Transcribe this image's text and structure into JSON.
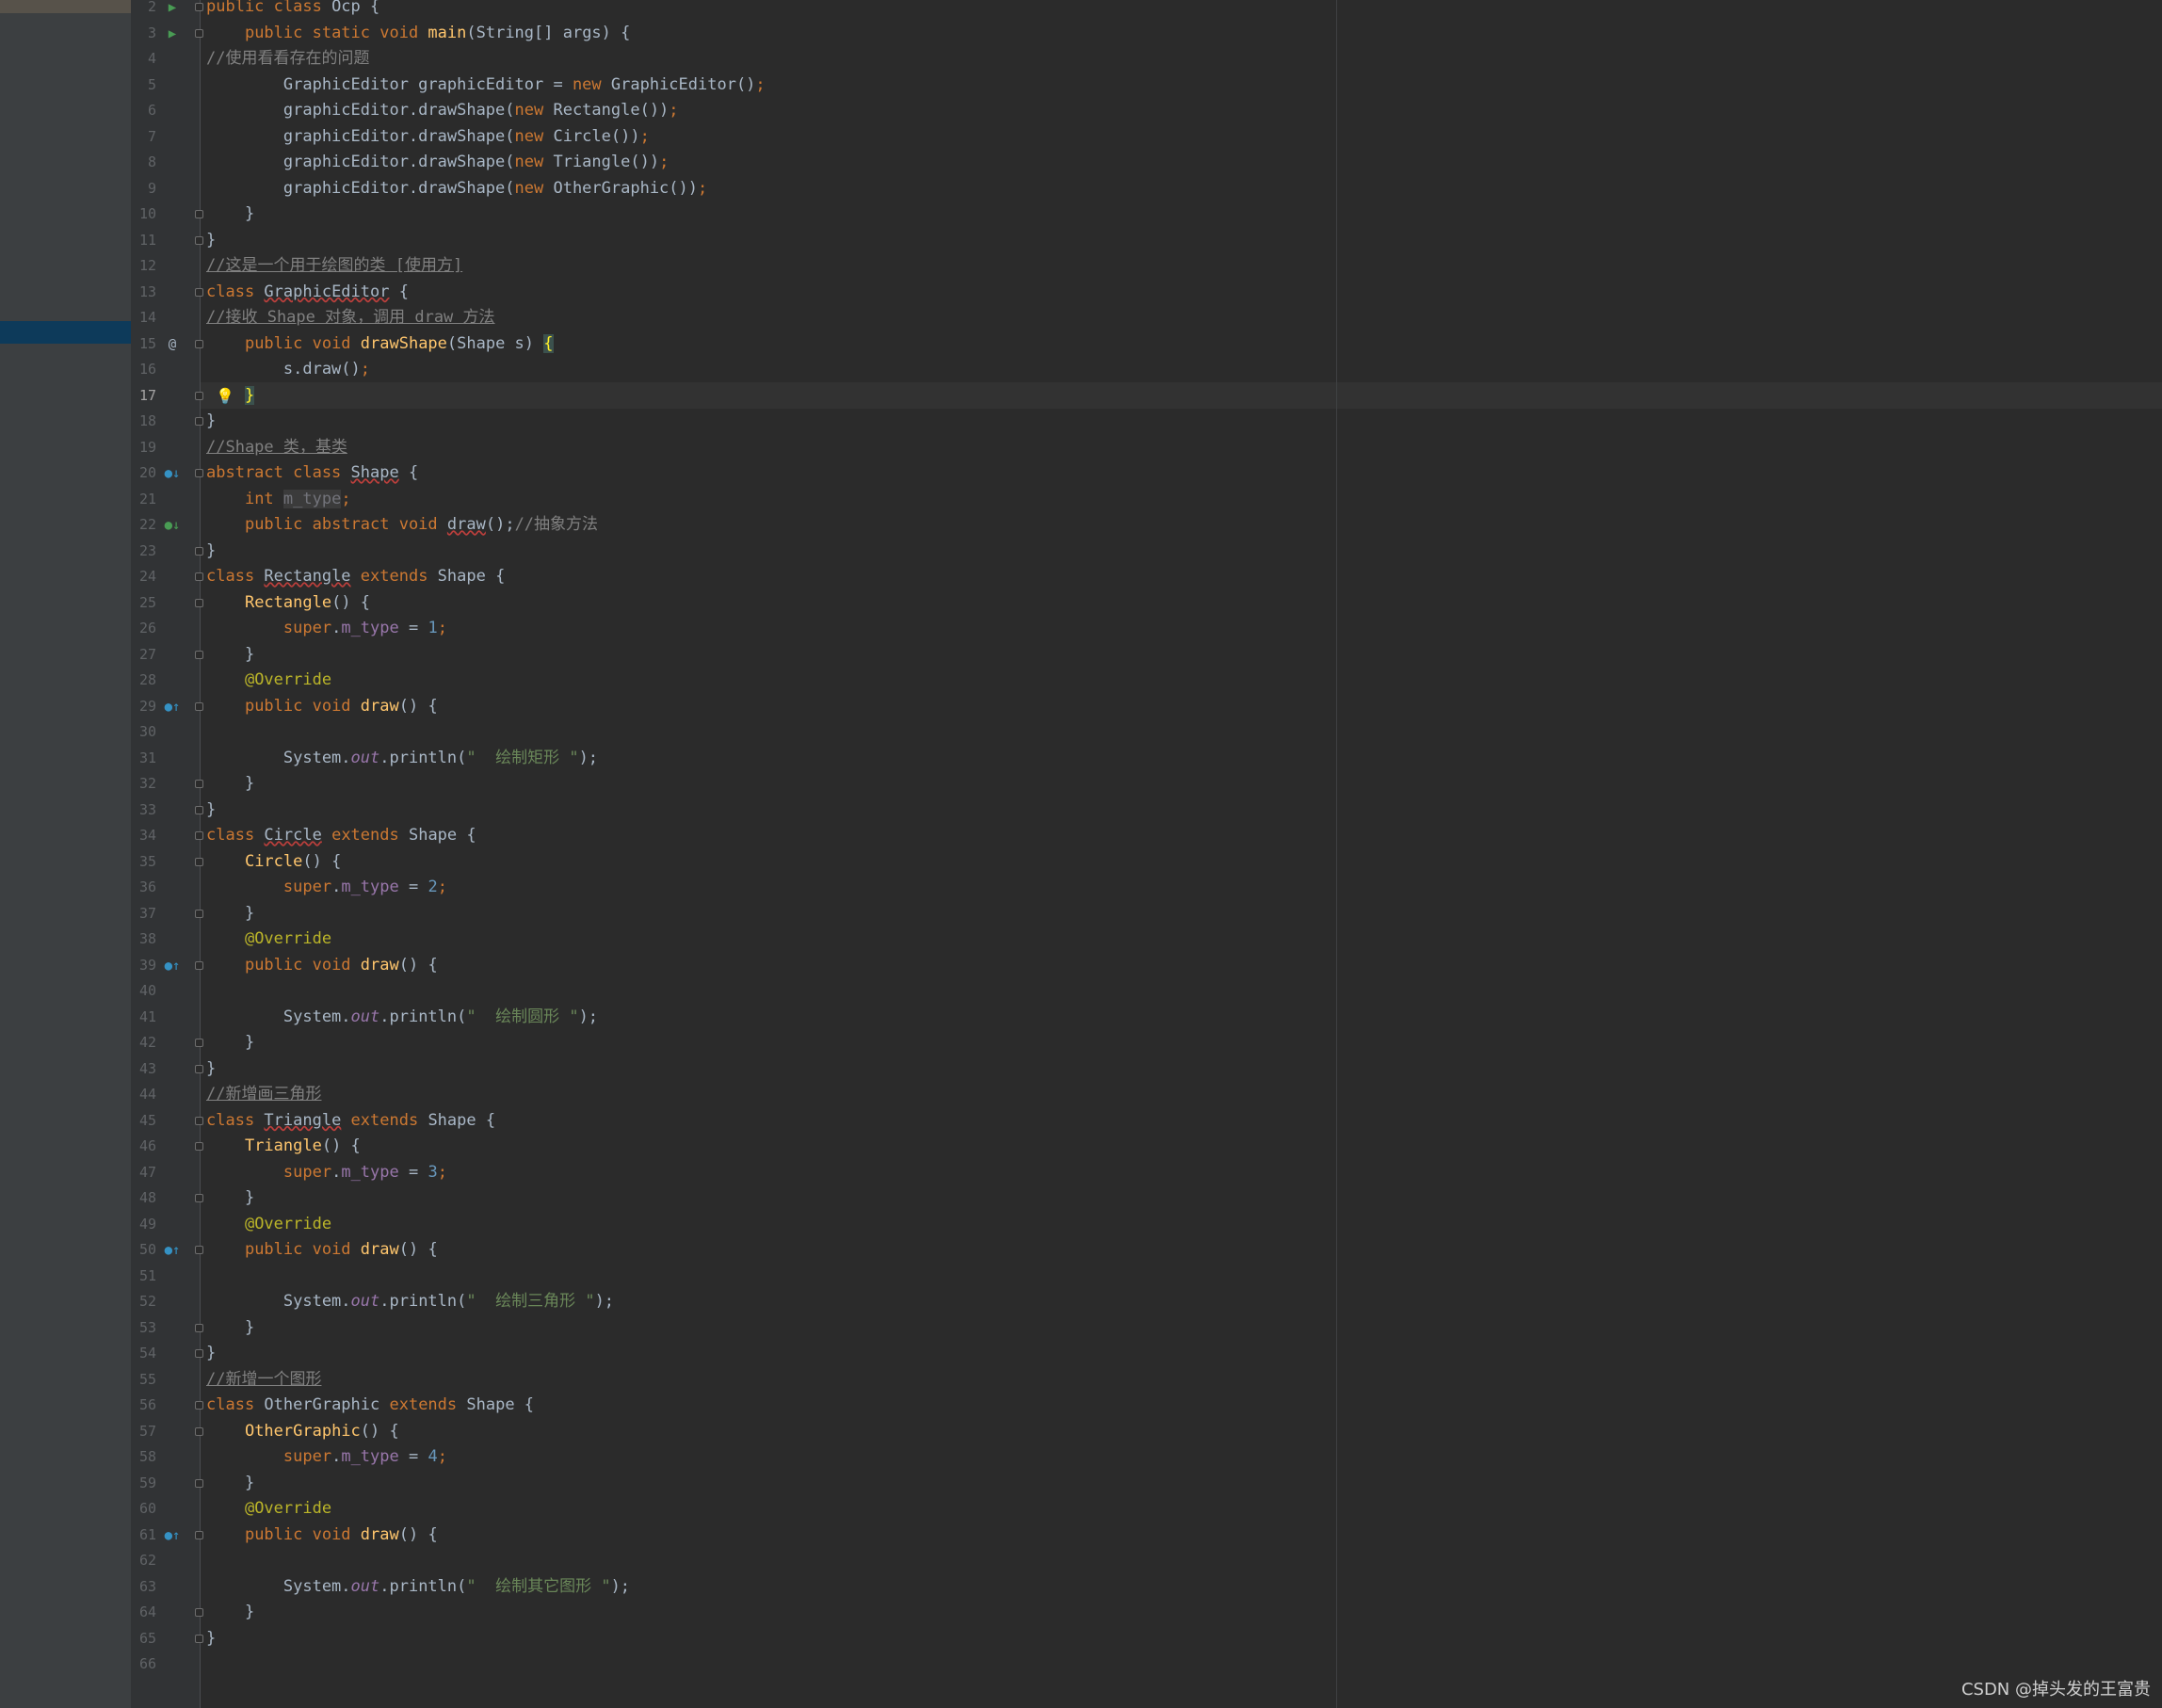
{
  "editor": {
    "current_line": "17",
    "watermark": "CSDN @掉头发的王富贵"
  },
  "lines": [
    {
      "n": "2",
      "segs": [
        [
          "kw",
          "public class "
        ],
        [
          "",
          "Ocp {"
        ]
      ],
      "icon": "run",
      "fold": true
    },
    {
      "n": "3",
      "segs": [
        [
          "",
          "    "
        ],
        [
          "kw",
          "public static void "
        ],
        [
          "fn",
          "main"
        ],
        [
          "",
          "(String[] args) {"
        ]
      ],
      "icon": "run",
      "fold": true
    },
    {
      "n": "4",
      "segs": [
        [
          "cm",
          "//使用看看存在的问题"
        ]
      ]
    },
    {
      "n": "5",
      "segs": [
        [
          "",
          "        GraphicEditor graphicEditor = "
        ],
        [
          "kw",
          "new "
        ],
        [
          "",
          "GraphicEditor()"
        ],
        [
          "kw",
          ";"
        ]
      ]
    },
    {
      "n": "6",
      "segs": [
        [
          "",
          "        graphicEditor.drawShape("
        ],
        [
          "kw",
          "new "
        ],
        [
          "",
          "Rectangle())"
        ],
        [
          "kw",
          ";"
        ]
      ]
    },
    {
      "n": "7",
      "segs": [
        [
          "",
          "        graphicEditor.drawShape("
        ],
        [
          "kw",
          "new "
        ],
        [
          "",
          "Circle())"
        ],
        [
          "kw",
          ";"
        ]
      ]
    },
    {
      "n": "8",
      "segs": [
        [
          "",
          "        graphicEditor.drawShape("
        ],
        [
          "kw",
          "new "
        ],
        [
          "",
          "Triangle())"
        ],
        [
          "kw",
          ";"
        ]
      ]
    },
    {
      "n": "9",
      "segs": [
        [
          "",
          "        graphicEditor.drawShape("
        ],
        [
          "kw",
          "new "
        ],
        [
          "",
          "OtherGraphic())"
        ],
        [
          "kw",
          ";"
        ]
      ]
    },
    {
      "n": "10",
      "segs": [
        [
          "",
          "    }"
        ]
      ],
      "fold": true
    },
    {
      "n": "11",
      "segs": [
        [
          "",
          "}"
        ]
      ],
      "fold": true
    },
    {
      "n": "12",
      "segs": [
        [
          "cmu",
          "//这是一个用于绘图的类 [使用方]"
        ]
      ]
    },
    {
      "n": "13",
      "segs": [
        [
          "kw",
          "class "
        ],
        [
          "err",
          "GraphicEditor"
        ],
        [
          "",
          " {"
        ]
      ],
      "fold": true
    },
    {
      "n": "14",
      "segs": [
        [
          "cmu",
          "//接收 Shape 对象，调用 draw 方法"
        ]
      ]
    },
    {
      "n": "15",
      "segs": [
        [
          "",
          "    "
        ],
        [
          "kw",
          "public void "
        ],
        [
          "fn",
          "drawShape"
        ],
        [
          "",
          "(Shape s) "
        ],
        [
          "brc",
          "{"
        ]
      ],
      "icon": "at",
      "fold": true
    },
    {
      "n": "16",
      "segs": [
        [
          "",
          "        s.draw()"
        ],
        [
          "kw",
          ";"
        ]
      ]
    },
    {
      "n": "17",
      "segs": [
        [
          "",
          "    "
        ],
        [
          "brc",
          "}"
        ]
      ],
      "fold": true,
      "bulb": true,
      "current": true
    },
    {
      "n": "18",
      "segs": [
        [
          "",
          "}"
        ]
      ],
      "fold": true
    },
    {
      "n": "19",
      "segs": [
        [
          "cmu",
          "//Shape 类，基类"
        ]
      ]
    },
    {
      "n": "20",
      "segs": [
        [
          "kw",
          "abstract class "
        ],
        [
          "err",
          "Shape"
        ],
        [
          "",
          " {"
        ]
      ],
      "icon": "impl-down",
      "fold": true
    },
    {
      "n": "21",
      "segs": [
        [
          "",
          "    "
        ],
        [
          "kw",
          "int "
        ],
        [
          "unused",
          "m_type"
        ],
        [
          "kw",
          ";"
        ]
      ]
    },
    {
      "n": "22",
      "segs": [
        [
          "",
          "    "
        ],
        [
          "kw",
          "public abstract void "
        ],
        [
          "err",
          "draw"
        ],
        [
          "",
          "();"
        ],
        [
          "cm",
          "//抽象方法"
        ]
      ],
      "icon": "impl-down-green"
    },
    {
      "n": "23",
      "segs": [
        [
          "",
          "}"
        ]
      ],
      "fold": true
    },
    {
      "n": "24",
      "segs": [
        [
          "kw",
          "class "
        ],
        [
          "err",
          "Rectangle"
        ],
        [
          "kw",
          " extends "
        ],
        [
          "",
          "Shape {"
        ]
      ],
      "fold": true
    },
    {
      "n": "25",
      "segs": [
        [
          "",
          "    "
        ],
        [
          "fn",
          "Rectangle"
        ],
        [
          "",
          "() {"
        ]
      ],
      "fold": true
    },
    {
      "n": "26",
      "segs": [
        [
          "",
          "        "
        ],
        [
          "kw",
          "super"
        ],
        [
          "",
          "."
        ],
        [
          "fld",
          "m_type"
        ],
        [
          "",
          " = "
        ],
        [
          "num",
          "1"
        ],
        [
          "kw",
          ";"
        ]
      ]
    },
    {
      "n": "27",
      "segs": [
        [
          "",
          "    }"
        ]
      ],
      "fold": true
    },
    {
      "n": "28",
      "segs": [
        [
          "",
          "    "
        ],
        [
          "ann",
          "@Override"
        ]
      ]
    },
    {
      "n": "29",
      "segs": [
        [
          "",
          "    "
        ],
        [
          "kw",
          "public void "
        ],
        [
          "fn",
          "draw"
        ],
        [
          "",
          "() {"
        ]
      ],
      "icon": "override-up",
      "fold": true
    },
    {
      "n": "30",
      "segs": []
    },
    {
      "n": "31",
      "segs": [
        [
          "",
          "        System."
        ],
        [
          "fldi",
          "out"
        ],
        [
          "",
          ".println("
        ],
        [
          "st",
          "\"  绘制矩形 \""
        ],
        [
          "",
          "); "
        ]
      ]
    },
    {
      "n": "32",
      "segs": [
        [
          "",
          "    }"
        ]
      ],
      "fold": true
    },
    {
      "n": "33",
      "segs": [
        [
          "",
          "}"
        ]
      ],
      "fold": true
    },
    {
      "n": "34",
      "segs": [
        [
          "kw",
          "class "
        ],
        [
          "err",
          "Circle"
        ],
        [
          "kw",
          " extends "
        ],
        [
          "",
          "Shape {"
        ]
      ],
      "fold": true
    },
    {
      "n": "35",
      "segs": [
        [
          "",
          "    "
        ],
        [
          "fn",
          "Circle"
        ],
        [
          "",
          "() {"
        ]
      ],
      "fold": true
    },
    {
      "n": "36",
      "segs": [
        [
          "",
          "        "
        ],
        [
          "kw",
          "super"
        ],
        [
          "",
          "."
        ],
        [
          "fld",
          "m_type"
        ],
        [
          "",
          " = "
        ],
        [
          "num",
          "2"
        ],
        [
          "kw",
          ";"
        ]
      ]
    },
    {
      "n": "37",
      "segs": [
        [
          "",
          "    }"
        ]
      ],
      "fold": true
    },
    {
      "n": "38",
      "segs": [
        [
          "",
          "    "
        ],
        [
          "ann",
          "@Override"
        ]
      ]
    },
    {
      "n": "39",
      "segs": [
        [
          "",
          "    "
        ],
        [
          "kw",
          "public void "
        ],
        [
          "fn",
          "draw"
        ],
        [
          "",
          "() {"
        ]
      ],
      "icon": "override-up",
      "fold": true
    },
    {
      "n": "40",
      "segs": []
    },
    {
      "n": "41",
      "segs": [
        [
          "",
          "        System."
        ],
        [
          "fldi",
          "out"
        ],
        [
          "",
          ".println("
        ],
        [
          "st",
          "\"  绘制圆形 \""
        ],
        [
          "",
          "); "
        ]
      ]
    },
    {
      "n": "42",
      "segs": [
        [
          "",
          "    }"
        ]
      ],
      "fold": true
    },
    {
      "n": "43",
      "segs": [
        [
          "",
          "}"
        ]
      ],
      "fold": true
    },
    {
      "n": "44",
      "segs": [
        [
          "cmu",
          "//新增画三角形"
        ]
      ]
    },
    {
      "n": "45",
      "segs": [
        [
          "kw",
          "class "
        ],
        [
          "err",
          "Triangle"
        ],
        [
          "kw",
          " extends "
        ],
        [
          "",
          "Shape {"
        ]
      ],
      "fold": true
    },
    {
      "n": "46",
      "segs": [
        [
          "",
          "    "
        ],
        [
          "fn",
          "Triangle"
        ],
        [
          "",
          "() {"
        ]
      ],
      "fold": true
    },
    {
      "n": "47",
      "segs": [
        [
          "",
          "        "
        ],
        [
          "kw",
          "super"
        ],
        [
          "",
          "."
        ],
        [
          "fld",
          "m_type"
        ],
        [
          "",
          " = "
        ],
        [
          "num",
          "3"
        ],
        [
          "kw",
          ";"
        ]
      ]
    },
    {
      "n": "48",
      "segs": [
        [
          "",
          "    }"
        ]
      ],
      "fold": true
    },
    {
      "n": "49",
      "segs": [
        [
          "",
          "    "
        ],
        [
          "ann",
          "@Override"
        ]
      ]
    },
    {
      "n": "50",
      "segs": [
        [
          "",
          "    "
        ],
        [
          "kw",
          "public void "
        ],
        [
          "fn",
          "draw"
        ],
        [
          "",
          "() {"
        ]
      ],
      "icon": "override-up",
      "fold": true
    },
    {
      "n": "51",
      "segs": []
    },
    {
      "n": "52",
      "segs": [
        [
          "",
          "        System."
        ],
        [
          "fldi",
          "out"
        ],
        [
          "",
          ".println("
        ],
        [
          "st",
          "\"  绘制三角形 \""
        ],
        [
          "",
          "); "
        ]
      ]
    },
    {
      "n": "53",
      "segs": [
        [
          "",
          "    }"
        ]
      ],
      "fold": true
    },
    {
      "n": "54",
      "segs": [
        [
          "",
          "}"
        ]
      ],
      "fold": true
    },
    {
      "n": "55",
      "segs": [
        [
          "cmu",
          "//新增一个图形"
        ]
      ]
    },
    {
      "n": "56",
      "segs": [
        [
          "kw",
          "class "
        ],
        [
          "",
          "OtherGraphic"
        ],
        [
          "kw",
          " extends "
        ],
        [
          "",
          "Shape {"
        ]
      ],
      "fold": true
    },
    {
      "n": "57",
      "segs": [
        [
          "",
          "    "
        ],
        [
          "fn",
          "OtherGraphic"
        ],
        [
          "",
          "() {"
        ]
      ],
      "fold": true
    },
    {
      "n": "58",
      "segs": [
        [
          "",
          "        "
        ],
        [
          "kw",
          "super"
        ],
        [
          "",
          "."
        ],
        [
          "fld",
          "m_type"
        ],
        [
          "",
          " = "
        ],
        [
          "num",
          "4"
        ],
        [
          "kw",
          ";"
        ]
      ]
    },
    {
      "n": "59",
      "segs": [
        [
          "",
          "    }"
        ]
      ],
      "fold": true
    },
    {
      "n": "60",
      "segs": [
        [
          "",
          "    "
        ],
        [
          "ann",
          "@Override"
        ]
      ]
    },
    {
      "n": "61",
      "segs": [
        [
          "",
          "    "
        ],
        [
          "kw",
          "public void "
        ],
        [
          "fn",
          "draw"
        ],
        [
          "",
          "() {"
        ]
      ],
      "icon": "override-up",
      "fold": true
    },
    {
      "n": "62",
      "segs": []
    },
    {
      "n": "63",
      "segs": [
        [
          "",
          "        System."
        ],
        [
          "fldi",
          "out"
        ],
        [
          "",
          ".println("
        ],
        [
          "st",
          "\"  绘制其它图形 \""
        ],
        [
          "",
          "); "
        ]
      ]
    },
    {
      "n": "64",
      "segs": [
        [
          "",
          "    }"
        ]
      ],
      "fold": true
    },
    {
      "n": "65",
      "segs": [
        [
          "",
          "}"
        ]
      ],
      "fold": true
    },
    {
      "n": "66",
      "segs": []
    }
  ]
}
